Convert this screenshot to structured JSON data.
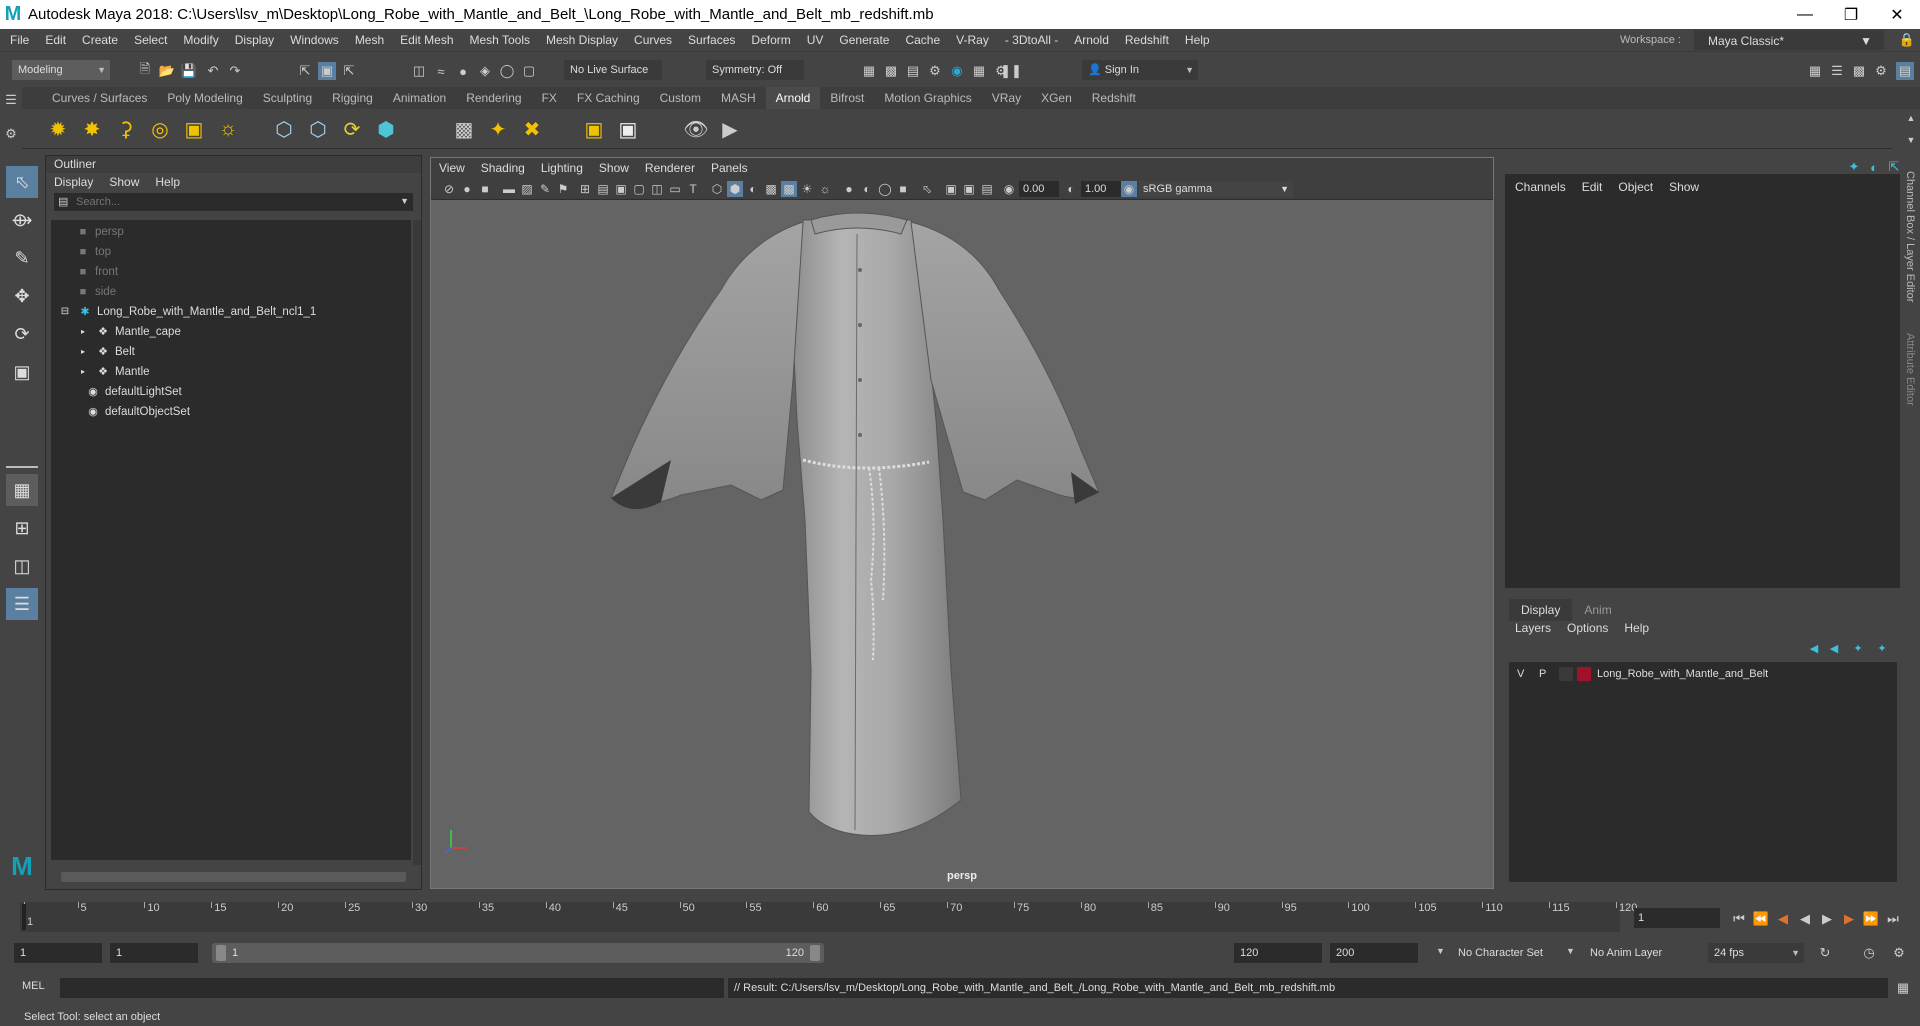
{
  "window": {
    "title": "Autodesk Maya 2018: C:\\Users\\lsv_m\\Desktop\\Long_Robe_with_Mantle_and_Belt_\\Long_Robe_with_Mantle_and_Belt_mb_redshift.mb"
  },
  "menubar": [
    "File",
    "Edit",
    "Create",
    "Select",
    "Modify",
    "Display",
    "Windows",
    "Mesh",
    "Edit Mesh",
    "Mesh Tools",
    "Mesh Display",
    "Curves",
    "Surfaces",
    "Deform",
    "UV",
    "Generate",
    "Cache",
    "V-Ray",
    "- 3DtoAll -",
    "Arnold",
    "Redshift",
    "Help"
  ],
  "workspace": {
    "label": "Workspace :",
    "value": "Maya Classic*"
  },
  "status": {
    "mode": "Modeling",
    "live_surface": "No Live Surface",
    "symmetry": "Symmetry: Off",
    "sign_in": "Sign In"
  },
  "shelf": {
    "tabs": [
      "Curves / Surfaces",
      "Poly Modeling",
      "Sculpting",
      "Rigging",
      "Animation",
      "Rendering",
      "FX",
      "FX Caching",
      "Custom",
      "MASH",
      "Arnold",
      "Bifrost",
      "Motion Graphics",
      "VRay",
      "XGen",
      "Redshift"
    ],
    "active": "Arnold"
  },
  "outliner": {
    "title": "Outliner",
    "menu": [
      "Display",
      "Show",
      "Help"
    ],
    "search_placeholder": "Search...",
    "items": [
      {
        "label": "persp",
        "type": "camera"
      },
      {
        "label": "top",
        "type": "camera"
      },
      {
        "label": "front",
        "type": "camera"
      },
      {
        "label": "side",
        "type": "camera"
      },
      {
        "label": "Long_Robe_with_Mantle_and_Belt_ncl1_1",
        "type": "group"
      },
      {
        "label": "Mantle_cape",
        "type": "mesh"
      },
      {
        "label": "Belt",
        "type": "mesh"
      },
      {
        "label": "Mantle",
        "type": "mesh"
      },
      {
        "label": "defaultLightSet",
        "type": "set"
      },
      {
        "label": "defaultObjectSet",
        "type": "set"
      }
    ]
  },
  "viewport": {
    "menu": [
      "View",
      "Shading",
      "Lighting",
      "Show",
      "Renderer",
      "Panels"
    ],
    "exposure": "0.00",
    "gamma": "1.00",
    "color_space": "sRGB gamma",
    "camera_label": "persp"
  },
  "channelbox": {
    "menu": [
      "Channels",
      "Edit",
      "Object",
      "Show"
    ]
  },
  "layers": {
    "tabs": [
      "Display",
      "Anim"
    ],
    "menu": [
      "Layers",
      "Options",
      "Help"
    ],
    "rows": [
      {
        "v": "V",
        "p": "P",
        "name": "Long_Robe_with_Mantle_and_Belt",
        "color": "#a0122c"
      }
    ]
  },
  "side_tabs": [
    "Channel Box / Layer Editor",
    "Attribute Editor"
  ],
  "timeline": {
    "ticks": [
      "1",
      "5",
      "10",
      "15",
      "20",
      "25",
      "30",
      "35",
      "40",
      "45",
      "50",
      "55",
      "60",
      "65",
      "70",
      "75",
      "80",
      "85",
      "90",
      "95",
      "100",
      "105",
      "110",
      "115",
      "120"
    ],
    "current_frame": "1"
  },
  "range": {
    "start": "1",
    "anim_start": "1",
    "slider_start": "1",
    "slider_end": "120",
    "anim_end": "120",
    "end": "200",
    "character_set": "No Character Set",
    "anim_layer": "No Anim Layer",
    "fps": "24 fps"
  },
  "command": {
    "lang": "MEL",
    "result": "// Result: C:/Users/lsv_m/Desktop/Long_Robe_with_Mantle_and_Belt_/Long_Robe_with_Mantle_and_Belt_mb_redshift.mb"
  },
  "helpline": "Select Tool: select an object",
  "colors": {
    "accent": "#16a0b8",
    "panel": "#444444",
    "field": "#2b2b2b",
    "viewport": "#646464",
    "layer_color": "#a0122c"
  }
}
